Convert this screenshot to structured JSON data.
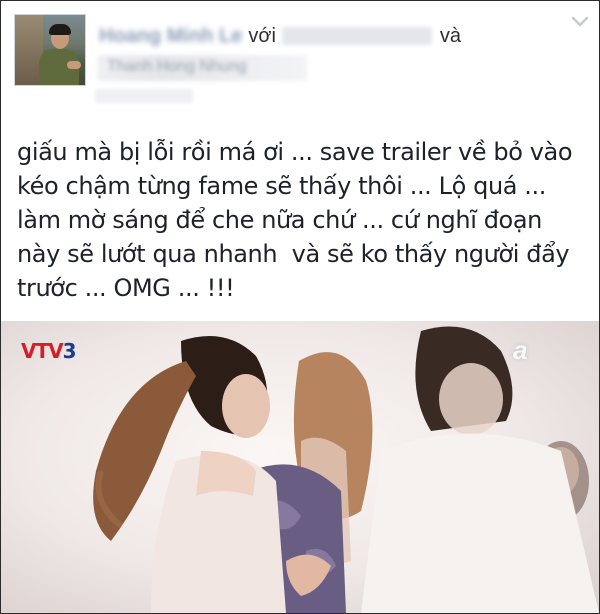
{
  "post": {
    "with_word": "với",
    "and_word": "và",
    "body_text": "giấu mà bị lỗi rồi má ơi ... save trailer về bỏ vào\nkéo chậm từng fame sẽ thấy thôi ... Lộ quá ...\nlàm mờ sáng để che nữa chứ ... cứ nghĩ đoạn\nnày sẽ lướt qua nhanh  và sẽ ko thấy người đẩy\ntrước ... OMG ... !!!",
    "author_blurred": "Hoang Minh Le",
    "tagged_blurred": "Thanh Hong Nhung"
  },
  "video": {
    "channel_logo_part1": "VTV",
    "channel_logo_part2": "3",
    "watermark": "a"
  },
  "icons": {
    "menu": "chevron-down-icon",
    "avatar": "avatar"
  }
}
